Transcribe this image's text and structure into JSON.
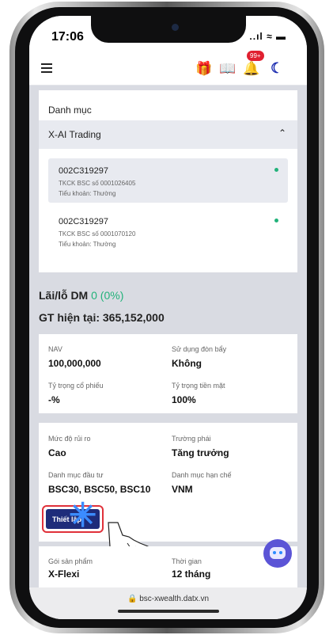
{
  "status": {
    "time": "17:06",
    "indicators": "..ıl ≈ ▬"
  },
  "topbar": {
    "menu_icon": "hamburger-icon",
    "gift_icon": "🎁",
    "book_icon": "📖",
    "bell_icon": "🔔",
    "notification_badge": "99+",
    "theme_icon": "☾"
  },
  "portfolio": {
    "title": "Danh mục",
    "group_name": "X-AI Trading",
    "chevron": "⌃",
    "accounts": [
      {
        "id": "002C319297",
        "line1": "TKCK BSC số 0001026405",
        "line2": "Tiểu khoản: Thường"
      },
      {
        "id": "002C319297",
        "line1": "TKCK BSC số 0001070120",
        "line2": "Tiểu khoản: Thường"
      }
    ]
  },
  "summary": {
    "pl_label": "Lãi/lỗ DM",
    "pl_value": "0 (0%)",
    "gt_label": "GT hiện tại:",
    "gt_value": "365,152,000"
  },
  "stats": {
    "nav_label": "NAV",
    "nav_value": "100,000,000",
    "leverage_label": "Sử dụng đòn bẩy",
    "leverage_value": "Không",
    "stock_ratio_label": "Tỷ trọng cổ phiếu",
    "stock_ratio_value": "-%",
    "cash_ratio_label": "Tỷ trọng tiền mặt",
    "cash_ratio_value": "100%"
  },
  "profile": {
    "risk_label": "Mức độ rủi ro",
    "risk_value": "Cao",
    "style_label": "Trường phái",
    "style_value": "Tăng trưởng",
    "invest_label": "Danh mục đầu tư",
    "invest_value": "BSC30, BSC50, BSC10",
    "restrict_label": "Danh mục hạn chế",
    "restrict_value": "VNM",
    "setup_button": "Thiết lập"
  },
  "product": {
    "package_label": "Gói sản phẩm",
    "package_value": "X-Flexi",
    "duration_label": "Thời gian",
    "duration_value": "12 tháng"
  },
  "browser": {
    "url": "🔒 bsc-xwealth.datx.vn"
  },
  "colors": {
    "accent": "#1e2c7a",
    "positive": "#22b27a",
    "badge": "#e02030",
    "highlight": "#e0313a",
    "bot": "#5b54d6"
  }
}
